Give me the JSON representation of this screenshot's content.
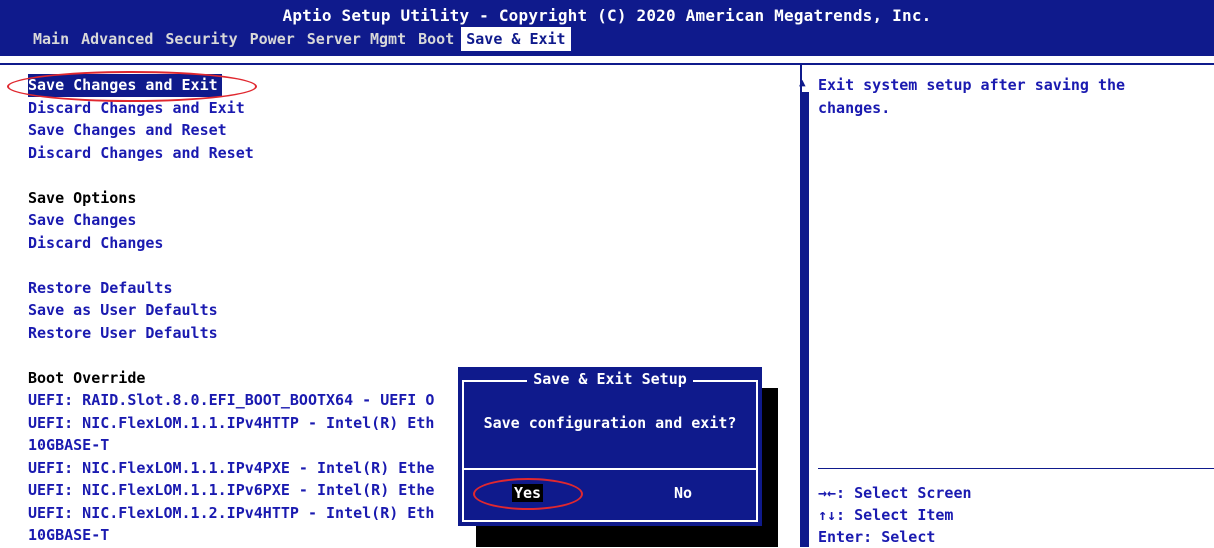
{
  "header": {
    "title": "Aptio Setup Utility - Copyright (C) 2020 American Megatrends, Inc.",
    "tabs": [
      "Main",
      "Advanced",
      "Security",
      "Power",
      "Server Mgmt",
      "Boot",
      "Save & Exit"
    ],
    "active_tab": "Save & Exit"
  },
  "menu": {
    "save_changes_and_exit": "Save Changes and Exit",
    "discard_changes_and_exit": "Discard Changes and Exit",
    "save_changes_and_reset": "Save Changes and Reset",
    "discard_changes_and_reset": "Discard Changes and Reset",
    "save_options": "Save Options",
    "save_changes": "Save Changes",
    "discard_changes": "Discard Changes",
    "restore_defaults": "Restore Defaults",
    "save_as_user_defaults": "Save as User Defaults",
    "restore_user_defaults": "Restore User Defaults",
    "boot_override": "Boot Override",
    "boot_items": [
      "UEFI: RAID.Slot.8.0.EFI_BOOT_BOOTX64 - UEFI O",
      "UEFI: NIC.FlexLOM.1.1.IPv4HTTP - Intel(R) Eth",
      "10GBASE-T",
      "UEFI: NIC.FlexLOM.1.1.IPv4PXE - Intel(R) Ethe",
      "UEFI: NIC.FlexLOM.1.1.IPv6PXE - Intel(R) Ethe",
      "UEFI: NIC.FlexLOM.1.2.IPv4HTTP - Intel(R) Eth",
      "10GBASE-T"
    ]
  },
  "help": {
    "line1": "Exit system setup after saving the",
    "line2": "changes."
  },
  "keys": [
    "→←: Select Screen",
    "↑↓: Select Item",
    "Enter: Select"
  ],
  "dialog": {
    "title": "Save & Exit Setup",
    "message": "Save configuration and exit?",
    "yes": "Yes",
    "no": "No"
  },
  "colors": {
    "bios_blue": "#0f1a8c",
    "item_blue": "#1a1ab0",
    "annotation_red": "#e0282f"
  }
}
